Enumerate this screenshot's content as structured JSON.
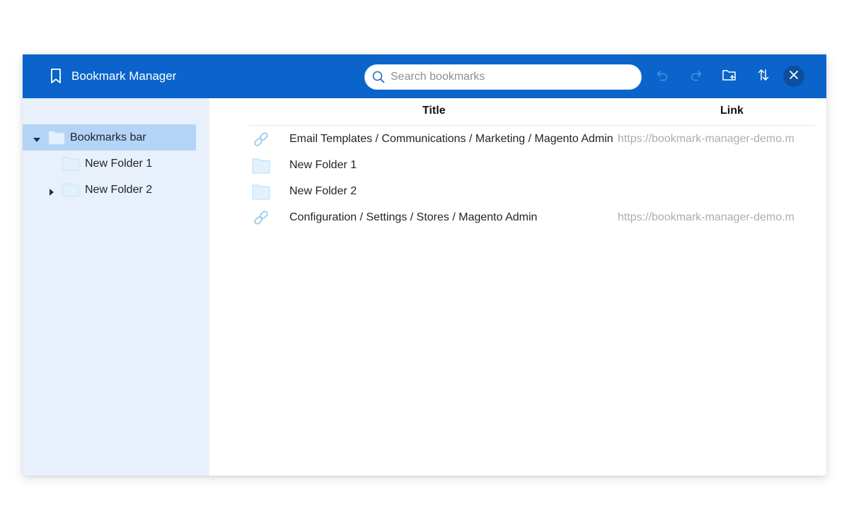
{
  "app": {
    "title": "Bookmark Manager",
    "brand_icon": "bookmark-icon",
    "accent_color": "#0a64cc"
  },
  "search": {
    "placeholder": "Search bookmarks",
    "value": "",
    "icon": "search-icon"
  },
  "toolbar": {
    "undo_icon": "undo-icon",
    "redo_icon": "redo-icon",
    "new_folder_icon": "new-folder-icon",
    "sort_icon": "sort-icon",
    "close_icon": "close-icon"
  },
  "sidebar": {
    "items": [
      {
        "label": "Bookmarks bar",
        "icon": "folder-icon",
        "expanded": true,
        "selected": true
      },
      {
        "label": "New Folder 1",
        "icon": "folder-icon"
      },
      {
        "label": "New Folder 2",
        "icon": "folder-icon",
        "expanded": false
      }
    ]
  },
  "table": {
    "columns": [
      "Title",
      "Link"
    ],
    "rows": [
      {
        "icon": "link-icon",
        "title": "Email Templates / Communications / Marketing / Magento Admin",
        "link": "https://bookmark-manager-demo.m"
      },
      {
        "icon": "folder-icon",
        "title": "New Folder 1",
        "link": ""
      },
      {
        "icon": "folder-icon",
        "title": "New Folder 2",
        "link": ""
      },
      {
        "icon": "link-icon",
        "title": "Configuration / Settings / Stores / Magento Admin",
        "link": "https://bookmark-manager-demo.m"
      }
    ]
  }
}
